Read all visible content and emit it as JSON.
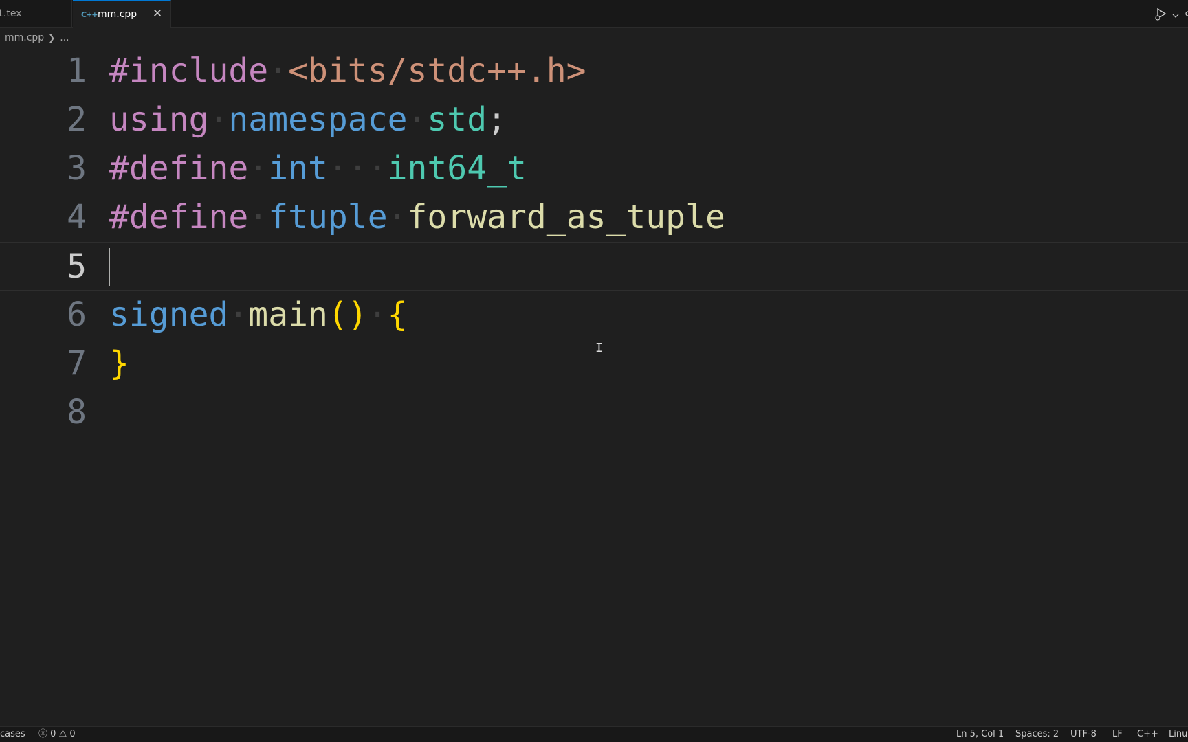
{
  "tabs": [
    {
      "label": "1.tex",
      "active": false
    },
    {
      "label": "mm.cpp",
      "active": true,
      "icon": "cpp-file-icon",
      "icon_text": "C++"
    }
  ],
  "breadcrumb": {
    "file": "mm.cpp",
    "ellipsis": "..."
  },
  "editor": {
    "line_numbers": [
      "1",
      "2",
      "3",
      "4",
      "5",
      "6",
      "7",
      "8"
    ],
    "current_line": 5,
    "code": {
      "line1": {
        "directive": "#include",
        "header": "<bits/stdc++.h>"
      },
      "line2": {
        "using": "using",
        "namespace": "namespace",
        "std": "std",
        "semi": ";"
      },
      "line3": {
        "directive": "#define",
        "name": "int",
        "value": "int64_t"
      },
      "line4": {
        "directive": "#define",
        "name": "ftuple",
        "value": "forward_as_tuple"
      },
      "line6": {
        "signed": "signed",
        "main": "main",
        "parens": "()",
        "open": "{"
      },
      "line7": {
        "close": "}"
      }
    }
  },
  "statusbar": {
    "left_item": "cases",
    "errors": "0",
    "warnings": "0",
    "position": "Ln 5, Col 1",
    "spaces": "Spaces: 2",
    "encoding": "UTF-8",
    "eol": "LF",
    "language": "C++",
    "platform": "Linu"
  },
  "colors": {
    "keyword": "#c586c0",
    "string": "#ce9178",
    "blue": "#569cd6",
    "type": "#4ec9b0",
    "function": "#dcdcaa",
    "brace": "#ffd700",
    "tab_accent": "#0078d4"
  }
}
